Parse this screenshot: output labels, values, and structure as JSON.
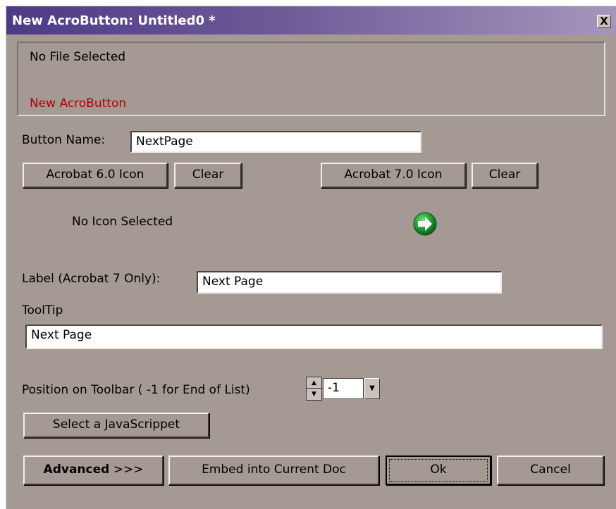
{
  "window": {
    "title": "New AcroButton: Untitled0 *",
    "close_label": "X"
  },
  "header_panel": {
    "file_status": "No File Selected",
    "button_title": "New AcroButton",
    "button_title_color": "#b00000"
  },
  "button_name": {
    "label": "Button Name:",
    "value": "NextPage"
  },
  "icons": {
    "acrobat6_button": "Acrobat 6.0 Icon",
    "acrobat6_clear": "Clear",
    "acrobat7_button": "Acrobat 7.0 Icon",
    "acrobat7_clear": "Clear",
    "acrobat6_status": "No Icon Selected",
    "acrobat7_icon": "green-right-arrow-icon"
  },
  "label_field": {
    "label": "Label (Acrobat 7 Only):",
    "value": "Next Page"
  },
  "tooltip": {
    "label": "ToolTip",
    "value": "Next Page"
  },
  "position": {
    "label": "Position on Toolbar ( -1 for End of List)",
    "value": "-1"
  },
  "javascript_button": "Select a JavaScrippet",
  "footer": {
    "advanced_bold": "Advanced",
    "advanced_arrows": ">>>",
    "embed": "Embed into Current Doc",
    "ok": "Ok",
    "cancel": "Cancel"
  },
  "colors": {
    "dialog_bg": "#a49a93",
    "title_gradient_start": "#4c3a86",
    "title_gradient_end": "#a596bd",
    "icon_green": "#1e8a2e"
  }
}
